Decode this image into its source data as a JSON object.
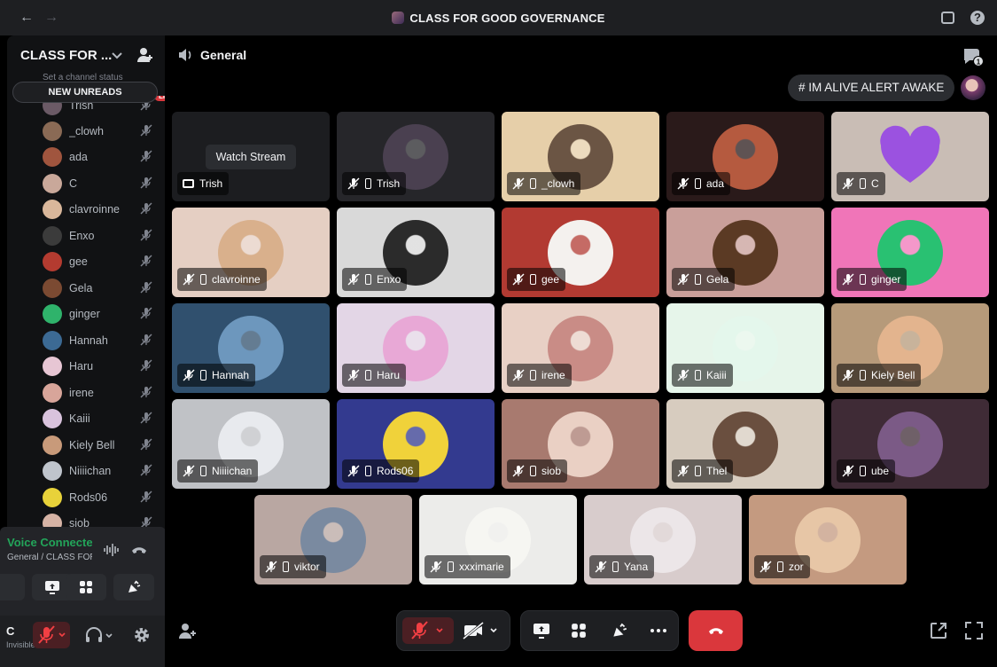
{
  "window": {
    "title": "CLASS FOR GOOD GOVERNANCE",
    "nav_back": "←",
    "nav_forward": "→",
    "help": "?"
  },
  "sidebar": {
    "server_name": "CLASS FOR ...",
    "chevron": "⌄",
    "status_hint": "Set a channel status",
    "new_unreads": "NEW UNREADS",
    "live_badge": "LIVE",
    "members": [
      {
        "name": "Trish",
        "color": "#6b5a66"
      },
      {
        "name": "_clowh",
        "color": "#8a6a55"
      },
      {
        "name": "ada",
        "color": "#a0553e"
      },
      {
        "name": "C",
        "color": "#c9a89a"
      },
      {
        "name": "clavroinne",
        "color": "#d9b79b"
      },
      {
        "name": "Enxo",
        "color": "#3b3b3b"
      },
      {
        "name": "gee",
        "color": "#b43b30"
      },
      {
        "name": "Gela",
        "color": "#7b4a32"
      },
      {
        "name": "ginger",
        "color": "#2fb36b"
      },
      {
        "name": "Hannah",
        "color": "#3c6a94"
      },
      {
        "name": "Haru",
        "color": "#e7c6d4"
      },
      {
        "name": "irene",
        "color": "#d8a59a"
      },
      {
        "name": "Kaiii",
        "color": "#d9c3dd"
      },
      {
        "name": "Kiely Bell",
        "color": "#c89a7a"
      },
      {
        "name": "Niiiichan",
        "color": "#bfc4cc"
      },
      {
        "name": "Rods06",
        "color": "#e8d23a"
      },
      {
        "name": "siob",
        "color": "#d6b3a5"
      }
    ]
  },
  "voice_panel": {
    "status": "Voice Connected",
    "channel": "General / CLASS FOR GOOD GOVERNANCE",
    "user_letter": "C",
    "user_sub": "Invisible"
  },
  "channel": {
    "name": "General",
    "thread_count": "1",
    "status": "# IM ALIVE ALERT AWAKE"
  },
  "tiles": [
    {
      "name": "Trish",
      "bg": "#1c1d20",
      "av": "",
      "stream": true,
      "watch": "Watch Stream"
    },
    {
      "name": "Trish",
      "bg": "#26262a",
      "av": "#4a4050"
    },
    {
      "name": "_clowh",
      "bg": "#e6cfa9",
      "av": "#6b5544"
    },
    {
      "name": "ada",
      "bg": "#2a1a1a",
      "av": "#b55a3f"
    },
    {
      "name": "C",
      "bg": "#c9bdb5",
      "av": "#9b52e0",
      "heart": true
    },
    {
      "name": "clavroinne",
      "bg": "#e5cfc3",
      "av": "#d9b08c"
    },
    {
      "name": "Enxo",
      "bg": "#d9d9d9",
      "av": "#2b2b2b"
    },
    {
      "name": "gee",
      "bg": "#b23a32",
      "av": "#f4f1ee"
    },
    {
      "name": "Gela",
      "bg": "#c99f9a",
      "av": "#5b3a24"
    },
    {
      "name": "ginger",
      "bg": "#f075b8",
      "av": "#29c172"
    },
    {
      "name": "Hannah",
      "bg": "#30506e",
      "av": "#6d97bd"
    },
    {
      "name": "Haru",
      "bg": "#e3d6e6",
      "av": "#e8a8d6"
    },
    {
      "name": "irene",
      "bg": "#e8d0c5",
      "av": "#c98c86"
    },
    {
      "name": "Kaiii",
      "bg": "#e6f5ea",
      "av": "#e4f7ec"
    },
    {
      "name": "Kiely Bell",
      "bg": "#b69a7a",
      "av": "#e3b48e"
    },
    {
      "name": "Niiiichan",
      "bg": "#c0c2c6",
      "av": "#e8eaee"
    },
    {
      "name": "Rods06",
      "bg": "#333a8f",
      "av": "#f0d23a"
    },
    {
      "name": "siob",
      "bg": "#a87a6f",
      "av": "#ead0c4"
    },
    {
      "name": "Thel",
      "bg": "#d7ccbf",
      "av": "#6a4f3f"
    },
    {
      "name": "ube",
      "bg": "#3f2b36",
      "av": "#7b5a86"
    },
    {
      "name": "viktor",
      "bg": "#b9a7a2",
      "av": "#7a8aa0"
    },
    {
      "name": "xxximarie",
      "bg": "#ececea",
      "av": "#f6f6f2"
    },
    {
      "name": "Yana",
      "bg": "#d8cccc",
      "av": "#ece6e8"
    },
    {
      "name": "zor",
      "bg": "#c49a80",
      "av": "#e7c6a6"
    }
  ],
  "colors": {
    "accent_green": "#23a55a",
    "danger": "#da373c",
    "panel": "#1e1f22"
  }
}
